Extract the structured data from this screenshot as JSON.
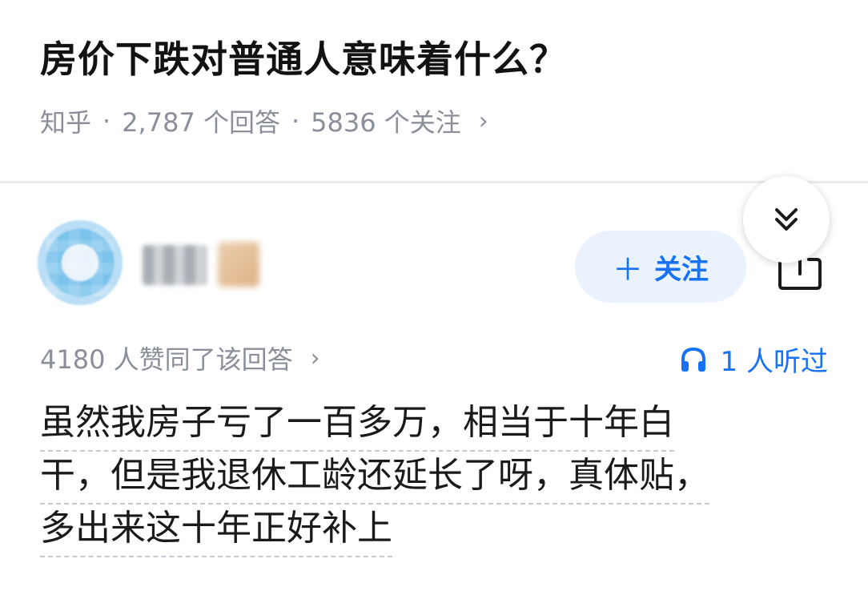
{
  "question": {
    "title": "房价下跌对普通人意味着什么？",
    "source": "知乎",
    "answer_count": "2,787 个回答",
    "follower_count": "5836 个关注",
    "separator": "·",
    "chevron": "›"
  },
  "author": {
    "follow_label": "关注",
    "follow_plus": "＋",
    "avatar_icon": "avatar-blurred",
    "share_icon": "share-icon",
    "collapse_icon": "double-chevron-down-icon"
  },
  "answer": {
    "upvote_text": "4180 人赞同了该回答",
    "chevron": "›",
    "listen_text": "1 人听过",
    "listen_icon": "headphones-icon",
    "lines": [
      "虽然我房子亏了一百多万，相当于十年白",
      "干，但是我退休工龄还延长了呀，真体贴，",
      "多出来这十年正好补上"
    ]
  },
  "colors": {
    "accent": "#1772f6",
    "follow_bg": "#eaf2fd",
    "meta_text": "#8a8f99"
  }
}
